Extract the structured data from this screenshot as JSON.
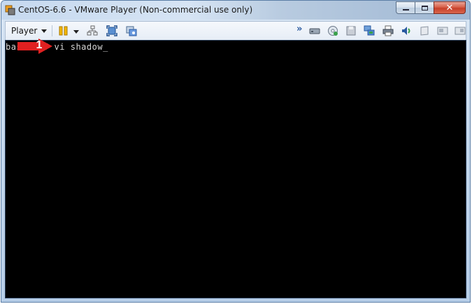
{
  "window": {
    "title": "CentOS-6.6 - VMware Player (Non-commercial use only)",
    "controls": {
      "minimize": "minimize-icon",
      "maximize": "maximize-icon",
      "close": "close-icon"
    }
  },
  "toolbar": {
    "player_label": "Player",
    "icons": [
      "pause-icon",
      "send-ctrl-alt-del-icon",
      "fullscreen-icon",
      "unity-icon",
      "more-icon",
      "hard-disk-icon",
      "cd-dvd-icon",
      "floppy-icon",
      "network-adapter-icon",
      "printer-icon",
      "sound-card-icon",
      "usb-device-icon",
      "hide-icon",
      "display-icon"
    ]
  },
  "terminal": {
    "prompt_start": "bas",
    "command_text": "# vi shadow",
    "cursor": "_"
  },
  "annotation": {
    "number": "1",
    "color": "#e02020"
  },
  "colors": {
    "screen_bg": "#000000",
    "terminal_text": "#d8d8d8",
    "accent_pause": "#f5b800"
  }
}
